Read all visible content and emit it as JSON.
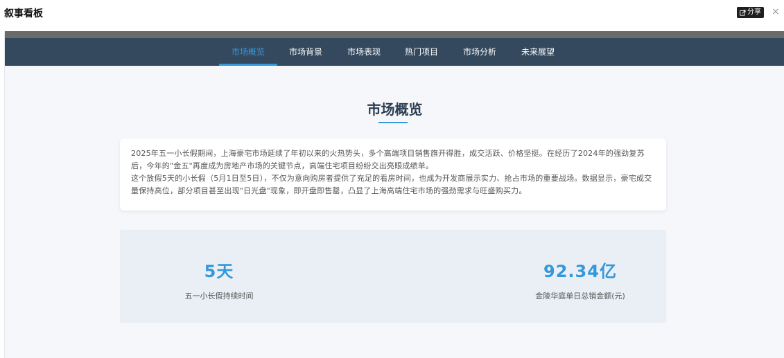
{
  "app": {
    "title": "叙事看板",
    "share_label": "分享",
    "close_glyph": "×"
  },
  "nav": {
    "items": [
      {
        "label": "市场概览",
        "active": true
      },
      {
        "label": "市场背景",
        "active": false
      },
      {
        "label": "市场表现",
        "active": false
      },
      {
        "label": "热门项目",
        "active": false
      },
      {
        "label": "市场分析",
        "active": false
      },
      {
        "label": "未来展望",
        "active": false
      }
    ]
  },
  "section": {
    "title": "市场概览",
    "paragraphs": [
      "2025年五一小长假期间，上海豪宅市场延续了年初以来的火热势头，多个高端项目销售旗开得胜，成交活跃、价格坚挺。在经历了2024年的强劲复苏后，今年的\"金五\"再度成为房地产市场的关键节点，高端住宅项目纷纷交出亮眼成绩单。",
      "这个放假5天的小长假（5月1日至5日），不仅为意向购房者提供了充足的看房时间，也成为开发商展示实力、抢占市场的重要战场。数据显示，豪宅成交量保持高位，部分项目甚至出现\"日光盘\"现象，即开盘即售罄，凸显了上海高端住宅市场的强劲需求与旺盛购买力。"
    ]
  },
  "stats": [
    {
      "value": "5天",
      "label": "五一小长假持续时间"
    },
    {
      "value": "92.34亿",
      "label": "金陵华庭单日总销金额(元)"
    }
  ],
  "colors": {
    "nav_bg": "#34495e",
    "accent": "#3498db",
    "heading": "#2c3e50"
  }
}
